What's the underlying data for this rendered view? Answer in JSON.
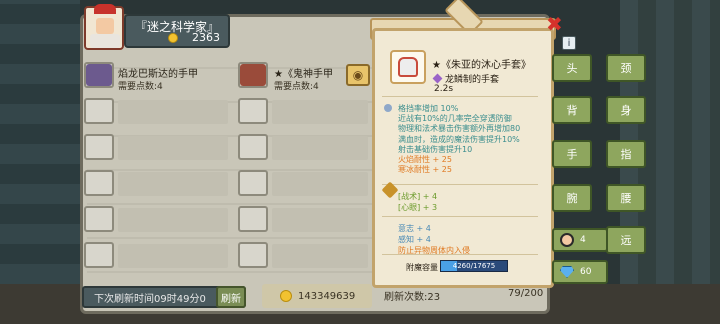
{
  "header": {
    "title": "『迷之科学家』",
    "coins": "2363"
  },
  "slots": [
    {
      "name": "焰龙巴斯达的手甲",
      "points": "需要点数:4"
    },
    {
      "name": "★《鬼神手甲",
      "points": "需要点数:4"
    }
  ],
  "tooltip": {
    "name": "★《朱亚的沐心手套》",
    "subtitle": "龙鳞制的手套",
    "time": "2.2s",
    "effects": [
      "格挡率增加 10%",
      "近战有10%的几率完全穿透防御",
      "物理和法术暴击伤害额外再增加80",
      "满血时，造成的魔法伤害提升10%",
      "射击基础伤害提升10"
    ],
    "resists": [
      "火焰耐性 + 25",
      "寒冰耐性 + 25"
    ],
    "green_stats": [
      "[战术] + 4",
      "[心眼] + 3"
    ],
    "blue_stats": [
      "意志 + 4",
      "感知 + 4"
    ],
    "warning": "防止异物周体内入侵",
    "capacity_label": "附魔容量",
    "capacity_value": "4260/17675",
    "capacity_fraction": 0.241
  },
  "bottom": {
    "refresh_text": "下次刷新时间09时49分0",
    "refresh_button": "刷新",
    "gold": "143349639",
    "refresh_count": "刷新次数:23",
    "capacity": "79/200"
  },
  "equipment": {
    "slots": [
      "头",
      "颈",
      "背",
      "身",
      "手",
      "指",
      "腕",
      "腰",
      "远"
    ],
    "pill_one": "4",
    "pill_two": "60"
  },
  "icons": [
    "close-icon",
    "info-icon",
    "lock-icon",
    "coin-icon",
    "gem-icon"
  ],
  "colors": {
    "effects": "#3b8e8e",
    "resist": "#e07a23",
    "green": "#6a9a2a",
    "button": "#8ea65e"
  }
}
